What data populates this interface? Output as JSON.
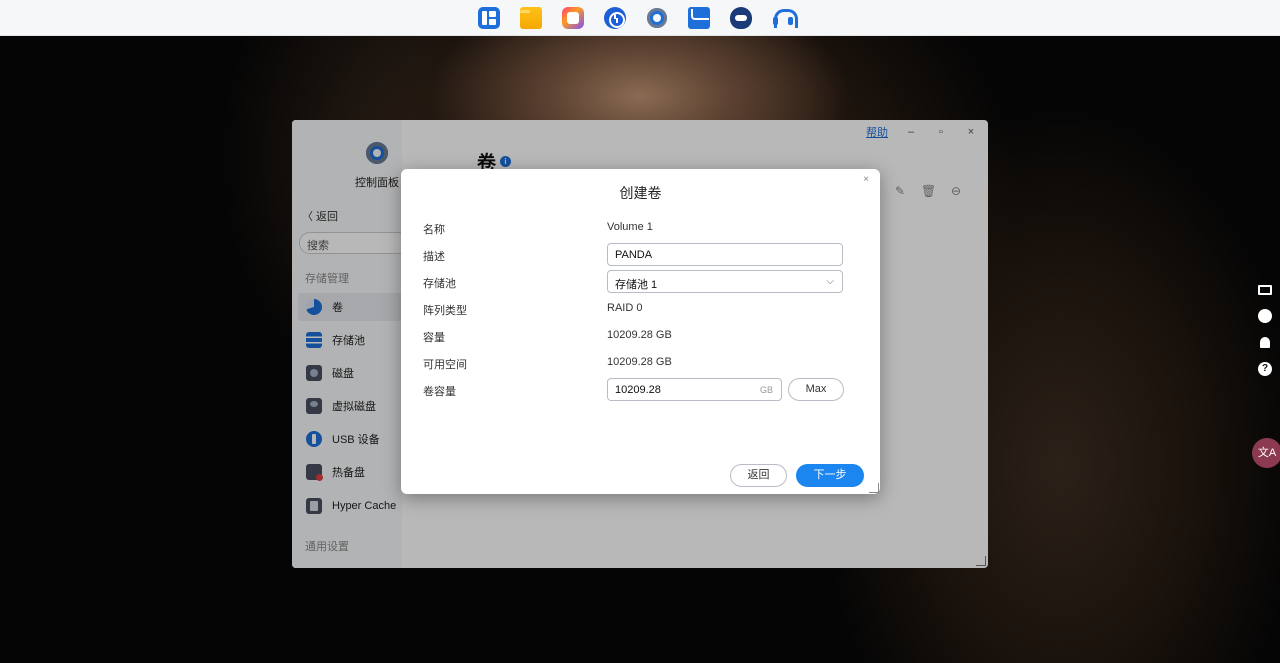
{
  "taskbar": {
    "apps": [
      {
        "name": "apps",
        "icon": "app-center-icon"
      },
      {
        "name": "files",
        "icon": "folder-icon"
      },
      {
        "name": "photos",
        "icon": "photos-icon"
      },
      {
        "name": "backup",
        "icon": "backup-clock-icon"
      },
      {
        "name": "settings",
        "icon": "gear-icon"
      },
      {
        "name": "mail",
        "icon": "mail-icon"
      },
      {
        "name": "docker",
        "icon": "docker-icon"
      },
      {
        "name": "support",
        "icon": "headset-icon"
      }
    ]
  },
  "right_panel": {
    "icons": [
      "monitor-icon",
      "chat-icon",
      "bell-icon",
      "help-icon"
    ],
    "help_glyph": "?",
    "translate_label": "文A"
  },
  "window": {
    "help_link": "帮助",
    "minimize": "–",
    "maximize": "▫",
    "close": "×",
    "app_title": "控制面板",
    "back_label": "〈 返回",
    "search_placeholder": "搜索",
    "section_storage": "存储管理",
    "nav": {
      "volume": "卷",
      "pool": "存储池",
      "disk": "磁盘",
      "virtual_disk": "虚拟磁盘",
      "usb": "USB 设备",
      "hot_spare": "热备盘",
      "hyper_cache": "Hyper Cache"
    },
    "section_general": "通用设置",
    "page_title": "卷",
    "info_glyph": "i",
    "toolbar": {
      "edit": "✎",
      "delete": "🗑",
      "more": "⊖"
    }
  },
  "modal": {
    "title": "创建卷",
    "close": "×",
    "labels": {
      "name": "名称",
      "description": "描述",
      "pool": "存储池",
      "raid_type": "阵列类型",
      "capacity": "容量",
      "free_space": "可用空间",
      "volume_capacity": "卷容量"
    },
    "values": {
      "name": "Volume 1",
      "description": "PANDA",
      "pool": "存储池 1",
      "raid_type": "RAID 0",
      "capacity": "10209.28 GB",
      "free_space": "10209.28 GB",
      "volume_capacity": "10209.28",
      "unit": "GB"
    },
    "buttons": {
      "max": "Max",
      "back": "返回",
      "next": "下一步"
    },
    "chevron": "⌵"
  },
  "colors": {
    "accent": "#1b86f0",
    "taskbar": "#f6f7f9"
  }
}
